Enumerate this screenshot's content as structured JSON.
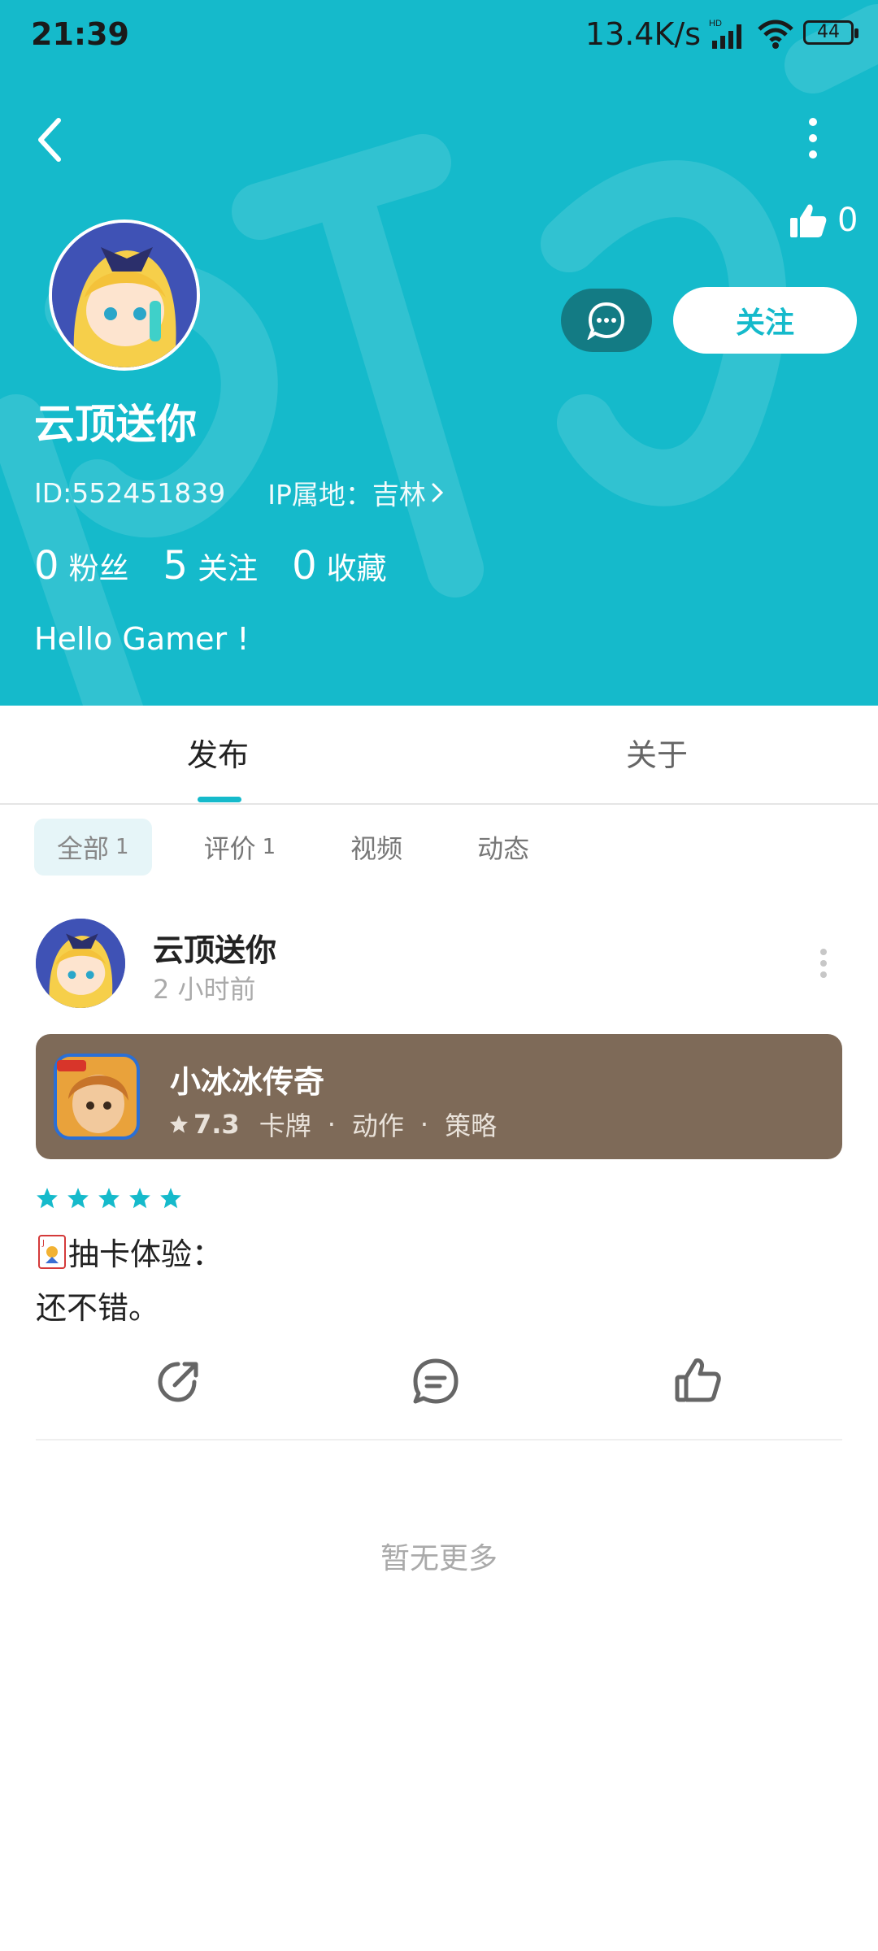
{
  "colors": {
    "accent": "#15BACB",
    "card": "#7E6A58",
    "message_button": "#137B84"
  },
  "status_bar": {
    "time": "21:39",
    "net_speed": "13.4K/s",
    "battery": "44"
  },
  "profile": {
    "likes": "0",
    "name": "云顶送你",
    "id_text": "ID:552451839",
    "ip_label": "IP属地：吉林",
    "follow_label": "关注",
    "stats": [
      {
        "num": "0",
        "label": "粉丝"
      },
      {
        "num": "5",
        "label": "关注"
      },
      {
        "num": "0",
        "label": "收藏"
      }
    ],
    "bio": "Hello Gamer !"
  },
  "tabs": {
    "publish": "发布",
    "about": "关于"
  },
  "filters": [
    {
      "label": "全部",
      "count": "1"
    },
    {
      "label": "评价",
      "count": "1"
    },
    {
      "label": "视频",
      "count": ""
    },
    {
      "label": "动态",
      "count": ""
    }
  ],
  "post": {
    "author": "云顶送你",
    "time": "2 小时前",
    "game": {
      "name": "小冰冰传奇",
      "rating": "7.3",
      "tags": [
        "卡牌",
        "动作",
        "策略"
      ]
    },
    "stars": 5,
    "review_title": "抽卡体验：",
    "review_body": "还不错。"
  },
  "footer": {
    "no_more": "暂无更多"
  },
  "icons": [
    "back-icon",
    "more-icon",
    "thumb-up-icon",
    "message-icon",
    "share-icon",
    "comment-icon",
    "star-icon",
    "card-emoji-icon"
  ]
}
